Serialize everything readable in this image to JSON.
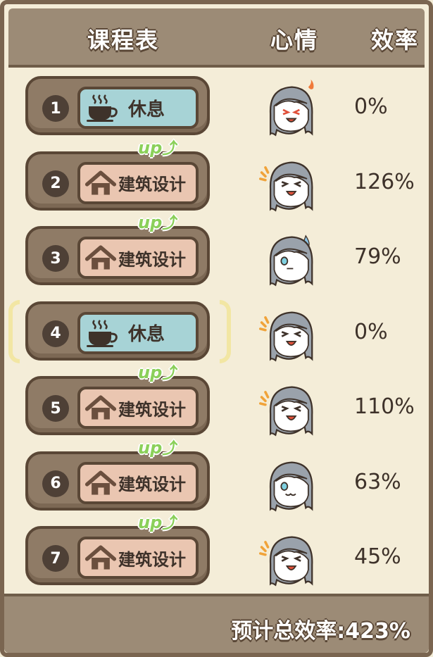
{
  "header": {
    "schedule": "课程表",
    "mood": "心情",
    "efficiency": "效率"
  },
  "rows": [
    {
      "num": "1",
      "course": "休息",
      "type": "rest",
      "up": false,
      "mood": "angry",
      "efficiency": "0%"
    },
    {
      "num": "2",
      "course": "建筑设计",
      "type": "build",
      "up": true,
      "mood": "happy",
      "efficiency": "126%"
    },
    {
      "num": "3",
      "course": "建筑设计",
      "type": "build",
      "up": true,
      "mood": "sweat",
      "efficiency": "79%"
    },
    {
      "num": "4",
      "course": "休息",
      "type": "rest",
      "up": false,
      "mood": "happy",
      "efficiency": "0%",
      "selected": true
    },
    {
      "num": "5",
      "course": "建筑设计",
      "type": "build",
      "up": true,
      "mood": "happy",
      "efficiency": "110%"
    },
    {
      "num": "6",
      "course": "建筑设计",
      "type": "build",
      "up": true,
      "mood": "content",
      "efficiency": "63%"
    },
    {
      "num": "7",
      "course": "建筑设计",
      "type": "build",
      "up": true,
      "mood": "happy",
      "efficiency": "45%"
    }
  ],
  "up_label": "up",
  "total": "预计总效率:423%",
  "colors": {
    "rest": "#a7d3d6",
    "build": "#eac6b1",
    "up": "#8bd05a",
    "panel": "#9c8b76"
  }
}
